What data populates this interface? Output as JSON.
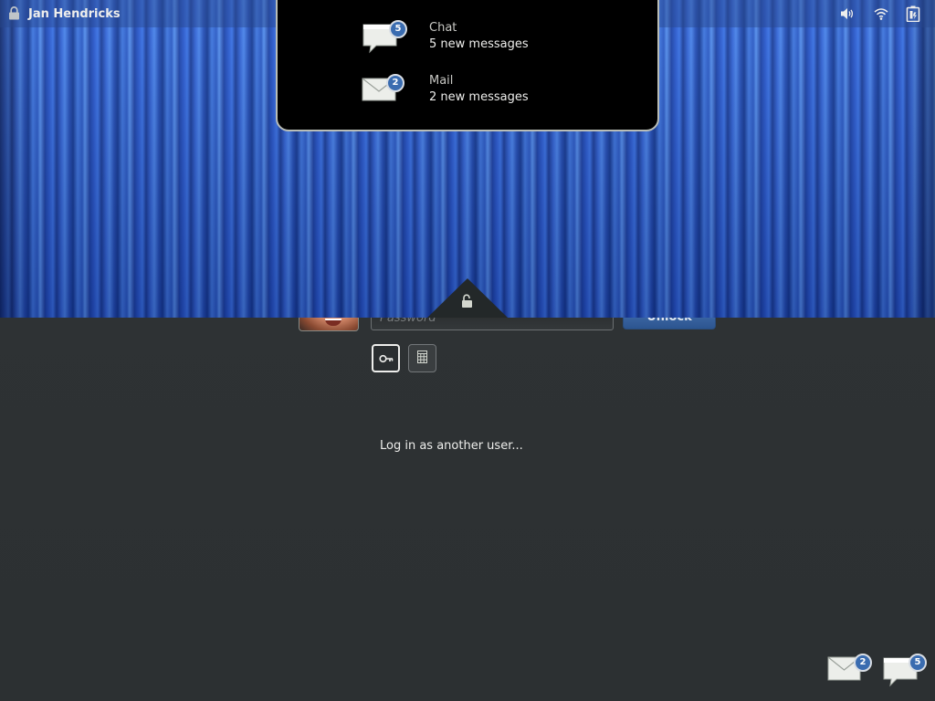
{
  "topbar": {
    "user_name": "Jan Hendricks",
    "icons": [
      "lock-icon",
      "volume-icon",
      "wifi-icon",
      "battery-icon"
    ]
  },
  "notifications": [
    {
      "app": "Chat",
      "summary": "5 new messages",
      "count": "5",
      "icon": "chat-bubble-icon"
    },
    {
      "app": "Mail",
      "summary": "2 new messages",
      "count": "2",
      "icon": "mail-envelope-icon"
    }
  ],
  "login": {
    "password_placeholder": "Password",
    "unlock_label": "Unlock",
    "another_user_label": "Log in as another user..."
  },
  "tray": [
    {
      "icon": "mail-envelope-icon",
      "count": "2"
    },
    {
      "icon": "chat-bubble-icon",
      "count": "5"
    }
  ],
  "colors": {
    "accent": "#3a6cb0",
    "background": "#2e3436",
    "curtain": "#2a5ad0"
  }
}
